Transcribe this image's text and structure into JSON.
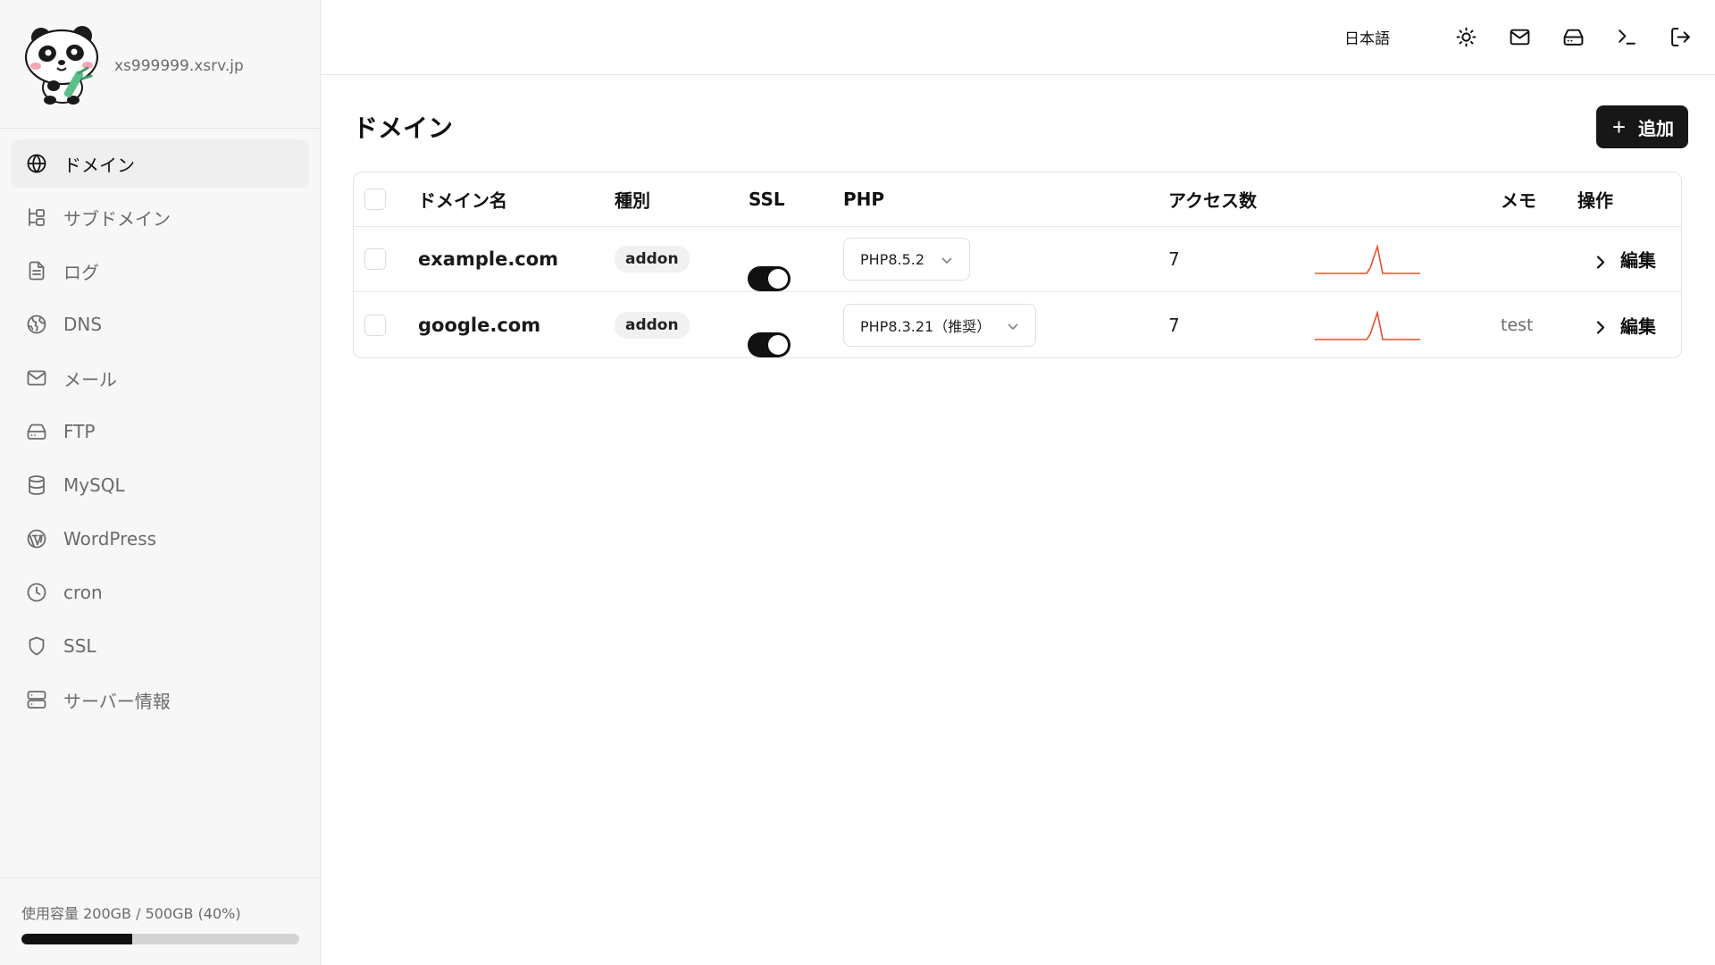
{
  "sidebar": {
    "host": "xs999999.xsrv.jp",
    "items": [
      {
        "label": "ドメイン",
        "icon": "globe-icon",
        "active": true
      },
      {
        "label": "サブドメイン",
        "icon": "subdomain-icon",
        "active": false
      },
      {
        "label": "ログ",
        "icon": "file-text-icon",
        "active": false
      },
      {
        "label": "DNS",
        "icon": "dns-globe-icon",
        "active": false
      },
      {
        "label": "メール",
        "icon": "mail-icon",
        "active": false
      },
      {
        "label": "FTP",
        "icon": "hard-drive-icon",
        "active": false
      },
      {
        "label": "MySQL",
        "icon": "database-icon",
        "active": false
      },
      {
        "label": "WordPress",
        "icon": "wordpress-icon",
        "active": false
      },
      {
        "label": "cron",
        "icon": "clock-icon",
        "active": false
      },
      {
        "label": "SSL",
        "icon": "shield-icon",
        "active": false
      },
      {
        "label": "サーバー情報",
        "icon": "server-icon",
        "active": false
      }
    ],
    "usage": {
      "text": "使用容量 200GB / 500GB (40%)",
      "percent": 40
    }
  },
  "topbar": {
    "language": "日本語",
    "icons": [
      "sun-icon",
      "mail-icon",
      "hard-drive-icon",
      "terminal-icon",
      "logout-icon"
    ]
  },
  "page": {
    "title": "ドメイン",
    "add_button": "追加"
  },
  "table": {
    "headers": {
      "domain": "ドメイン名",
      "type": "種別",
      "ssl": "SSL",
      "php": "PHP",
      "access": "アクセス数",
      "memo": "メモ",
      "actions": "操作"
    },
    "rows": [
      {
        "domain": "example.com",
        "type": "addon",
        "ssl": true,
        "php": "PHP8.5.2",
        "access": "7",
        "memo": "",
        "edit": "編集"
      },
      {
        "domain": "google.com",
        "type": "addon",
        "ssl": true,
        "php": "PHP8.3.21（推奨）",
        "access": "7",
        "memo": "test",
        "edit": "編集"
      }
    ]
  },
  "colors": {
    "accent": "#171717",
    "sparkline": "#e8502a",
    "sidebar_bg": "#f7f7f7"
  }
}
